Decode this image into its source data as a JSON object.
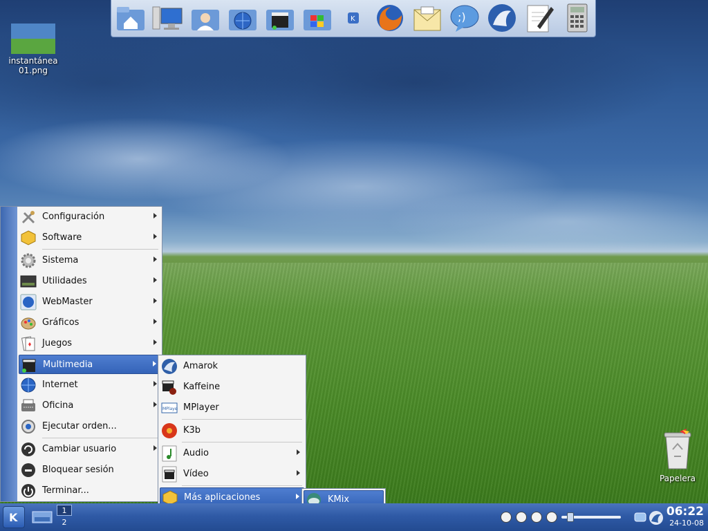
{
  "desktop_icons": {
    "screenshot_label": "instantánea\n01.png",
    "trash_label": "Papelera"
  },
  "launcher": {
    "items": [
      "home-folder",
      "computer",
      "user-folder",
      "network-folder",
      "multimedia-folder",
      "windows-folder",
      "kde",
      "firefox",
      "mail",
      "messenger",
      "kopete",
      "text-editor",
      "calculator"
    ]
  },
  "kmenu": {
    "items": [
      {
        "label": "Configuración",
        "icon": "tools-icon",
        "submenu": true
      },
      {
        "label": "Software",
        "icon": "package-icon",
        "submenu": true
      },
      {
        "label": "Sistema",
        "icon": "gear-icon",
        "submenu": true
      },
      {
        "label": "Utilidades",
        "icon": "terminal-icon",
        "submenu": true
      },
      {
        "label": "WebMaster",
        "icon": "globe-icon",
        "submenu": true
      },
      {
        "label": "Gráficos",
        "icon": "palette-icon",
        "submenu": true
      },
      {
        "label": "Juegos",
        "icon": "cards-icon",
        "submenu": true
      },
      {
        "label": "Multimedia",
        "icon": "clapper-icon",
        "submenu": true,
        "selected": true
      },
      {
        "label": "Internet",
        "icon": "globe-icon",
        "submenu": true
      },
      {
        "label": "Oficina",
        "icon": "typewriter-icon",
        "submenu": true
      },
      {
        "label": "Ejecutar orden...",
        "icon": "run-icon",
        "submenu": false
      },
      {
        "label": "Cambiar usuario",
        "icon": "switch-user-icon",
        "submenu": true
      },
      {
        "label": "Bloquear sesión",
        "icon": "lock-icon",
        "submenu": false
      },
      {
        "label": "Terminar...",
        "icon": "power-icon",
        "submenu": false
      }
    ]
  },
  "multimedia_submenu": {
    "items": [
      {
        "label": "Amarok",
        "submenu": false
      },
      {
        "label": "Kaffeine",
        "submenu": false
      },
      {
        "label": "MPlayer",
        "submenu": false
      },
      {
        "label": "K3b",
        "submenu": false
      },
      {
        "label": "Audio",
        "submenu": true
      },
      {
        "label": "Vídeo",
        "submenu": true
      },
      {
        "label": "Más aplicaciones",
        "submenu": true,
        "selected": true
      }
    ]
  },
  "more_apps_submenu": {
    "items": [
      {
        "label": "KMix",
        "selected": true
      }
    ]
  },
  "taskbar": {
    "desktop1": "1",
    "desktop2": "2",
    "time": "06:22",
    "date": "24-10-08"
  },
  "colors": {
    "selection": "#3463b8",
    "panel": "#2f5aa6"
  }
}
